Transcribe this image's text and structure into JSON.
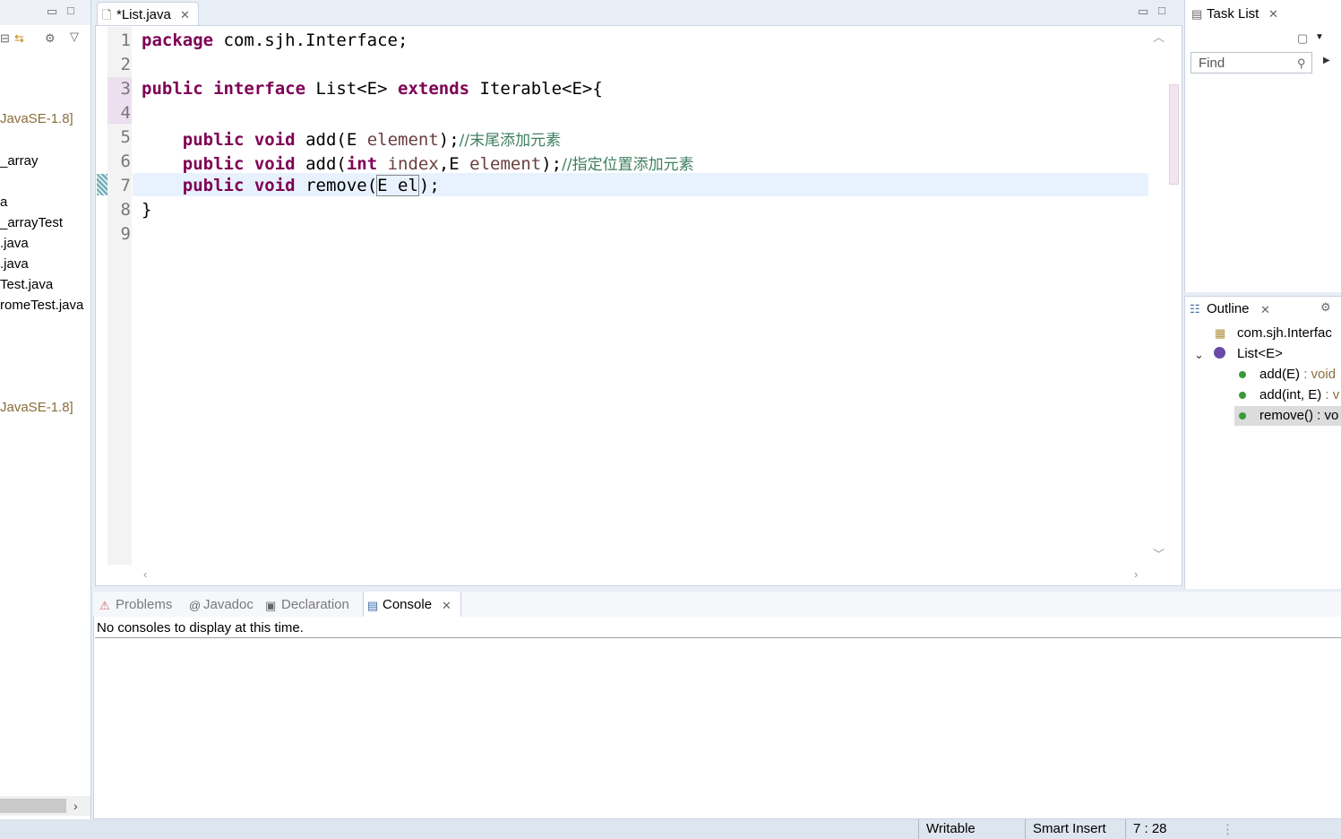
{
  "left_panel": {
    "items": [
      {
        "text": "JavaSE-1.8]",
        "gray": true
      },
      {
        "text": "_array",
        "gray": false
      },
      {
        "text": "a",
        "gray": false
      },
      {
        "text": "_arrayTest",
        "gray": false
      },
      {
        "text": ".java",
        "gray": false
      },
      {
        "text": ".java",
        "gray": false
      },
      {
        "text": "Test.java",
        "gray": false
      },
      {
        "text": "romeTest.java",
        "gray": false
      },
      {
        "text": "JavaSE-1.8]",
        "gray": true
      }
    ]
  },
  "editor": {
    "tab_label": "*List.java",
    "lines": [
      {
        "n": "1"
      },
      {
        "n": "2"
      },
      {
        "n": "3"
      },
      {
        "n": "4"
      },
      {
        "n": "5"
      },
      {
        "n": "6"
      },
      {
        "n": "7"
      },
      {
        "n": "8"
      },
      {
        "n": "9"
      }
    ],
    "code": {
      "l1_kw": "package",
      "l1_rest": " com.sjh.Interface;",
      "l3_kw1": "public",
      "l3_kw2": "interface",
      "l3_mid": " List<E> ",
      "l3_kw3": "extends",
      "l3_rest": " Iterable<E>{",
      "l5_kw1": "public",
      "l5_kw2": "void",
      "l5_a": " add(E ",
      "l5_var": "element",
      "l5_b": ");",
      "l5_cm": "//末尾添加元素",
      "l6_kw1": "public",
      "l6_kw2": "void",
      "l6_a": " add(",
      "l6_kw3": "int",
      "l6_var1": "index",
      "l6_b": ",E ",
      "l6_var2": "element",
      "l6_c": ");",
      "l6_cm": "//指定位置添加元素",
      "l7_kw1": "public",
      "l7_kw2": "void",
      "l7_a": " remove(",
      "l7_b": "E el",
      "l7_c": ");",
      "l8": "}"
    }
  },
  "task_list": {
    "tab_label": "Task List",
    "find_placeholder": "Find"
  },
  "outline": {
    "tab_label": "Outline",
    "package": "com.sjh.Interfac",
    "interface": "List<E>",
    "methods": [
      {
        "name": "add(E)",
        "ret": " : void"
      },
      {
        "name": "add(int, E)",
        "ret": " : v"
      },
      {
        "name": "remove() : vo",
        "ret": ""
      }
    ]
  },
  "console": {
    "tabs": [
      "Problems",
      "Javadoc",
      "Declaration",
      "Console"
    ],
    "message": "No consoles to display at this time."
  },
  "status_bar": {
    "writable": "Writable",
    "insert_mode": "Smart Insert",
    "position": "7 : 28"
  },
  "colors": {
    "keyword": "#7f0055",
    "comment": "#3f7f5f",
    "variable": "#6a3e3e",
    "current_line": "#e8f2fe"
  }
}
